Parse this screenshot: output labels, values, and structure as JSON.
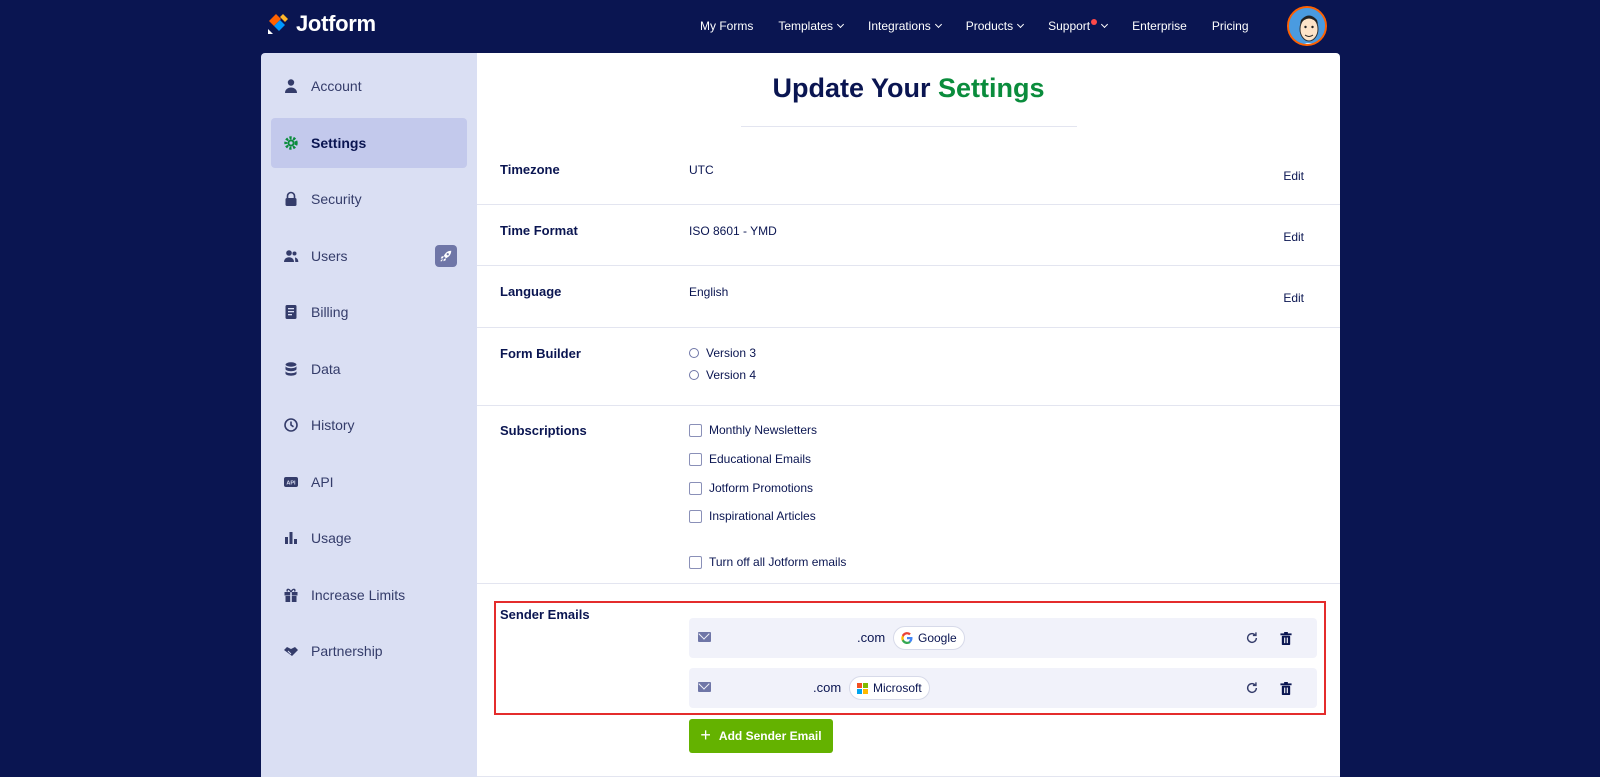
{
  "header": {
    "logo_text": "Jotform",
    "nav": [
      {
        "label": "My Forms",
        "dropdown": false,
        "notify": false
      },
      {
        "label": "Templates",
        "dropdown": true,
        "notify": false
      },
      {
        "label": "Integrations",
        "dropdown": true,
        "notify": false
      },
      {
        "label": "Products",
        "dropdown": true,
        "notify": false
      },
      {
        "label": "Support",
        "dropdown": true,
        "notify": true
      },
      {
        "label": "Enterprise",
        "dropdown": false,
        "notify": false
      },
      {
        "label": "Pricing",
        "dropdown": false,
        "notify": false
      }
    ]
  },
  "sidebar": {
    "items": [
      {
        "label": "Account",
        "icon": "user-icon",
        "active": false
      },
      {
        "label": "Settings",
        "icon": "gear-icon",
        "active": true
      },
      {
        "label": "Security",
        "icon": "lock-icon",
        "active": false
      },
      {
        "label": "Users",
        "icon": "users-icon",
        "active": false,
        "badge_icon": "rocket-icon"
      },
      {
        "label": "Billing",
        "icon": "billing-icon",
        "active": false
      },
      {
        "label": "Data",
        "icon": "database-icon",
        "active": false
      },
      {
        "label": "History",
        "icon": "history-icon",
        "active": false
      },
      {
        "label": "API",
        "icon": "api-icon",
        "active": false
      },
      {
        "label": "Usage",
        "icon": "bar-chart-icon",
        "active": false
      },
      {
        "label": "Increase Limits",
        "icon": "gift-icon",
        "active": false
      },
      {
        "label": "Partnership",
        "icon": "handshake-icon",
        "active": false
      }
    ]
  },
  "main": {
    "title_prefix": "Update Your",
    "title_accent": "Settings",
    "timezone": {
      "label": "Timezone",
      "value": "UTC",
      "edit": "Edit"
    },
    "time_format": {
      "label": "Time Format",
      "value": "ISO 8601 - YMD",
      "edit": "Edit"
    },
    "language": {
      "label": "Language",
      "value": "English",
      "edit": "Edit"
    },
    "form_builder": {
      "label": "Form Builder",
      "options": [
        "Version 3",
        "Version 4"
      ]
    },
    "subscriptions": {
      "label": "Subscriptions",
      "options": [
        "Monthly Newsletters",
        "Educational Emails",
        "Jotform Promotions",
        "Inspirational Articles"
      ],
      "turn_off": "Turn off all Jotform emails"
    },
    "sender_emails": {
      "label": "Sender Emails",
      "emails": [
        {
          "text": ".com",
          "provider": "Google"
        },
        {
          "text": ".com",
          "provider": "Microsoft"
        }
      ],
      "add_label": "Add Sender Email"
    }
  },
  "colors": {
    "navy": "#0a1551",
    "accent_green": "#0a8c3c",
    "button_green": "#64b200",
    "highlight_red": "#e42c2c",
    "sidebar_bg": "#dadff3"
  }
}
